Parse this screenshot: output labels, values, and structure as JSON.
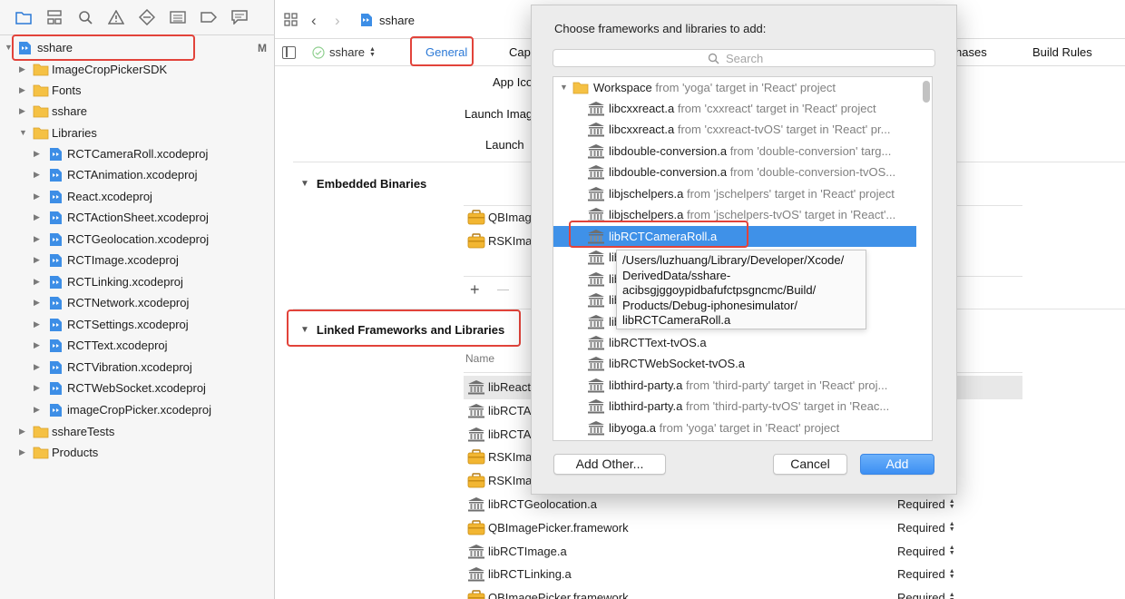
{
  "colors": {
    "accent": "#2a78d6",
    "selection": "#3f91e8",
    "highlight_box": "#e2433a",
    "folder": "#f5c144"
  },
  "navigator": {
    "toolbar_icons": [
      "folder-icon",
      "hierarchy-icon",
      "search-icon",
      "warning-icon",
      "diamond-icon",
      "list-icon",
      "tag-icon",
      "comment-icon"
    ],
    "root": {
      "label": "sshare",
      "badge": "M"
    },
    "items": [
      {
        "label": "ImageCropPickerSDK",
        "kind": "folder"
      },
      {
        "label": "Fonts",
        "kind": "folder"
      },
      {
        "label": "sshare",
        "kind": "folder"
      },
      {
        "label": "Libraries",
        "kind": "folder",
        "expanded": true
      },
      {
        "label": "RCTCameraRoll.xcodeproj",
        "kind": "project"
      },
      {
        "label": "RCTAnimation.xcodeproj",
        "kind": "project"
      },
      {
        "label": "React.xcodeproj",
        "kind": "project"
      },
      {
        "label": "RCTActionSheet.xcodeproj",
        "kind": "project"
      },
      {
        "label": "RCTGeolocation.xcodeproj",
        "kind": "project"
      },
      {
        "label": "RCTImage.xcodeproj",
        "kind": "project"
      },
      {
        "label": "RCTLinking.xcodeproj",
        "kind": "project"
      },
      {
        "label": "RCTNetwork.xcodeproj",
        "kind": "project"
      },
      {
        "label": "RCTSettings.xcodeproj",
        "kind": "project"
      },
      {
        "label": "RCTText.xcodeproj",
        "kind": "project"
      },
      {
        "label": "RCTVibration.xcodeproj",
        "kind": "project"
      },
      {
        "label": "RCTWebSocket.xcodeproj",
        "kind": "project"
      },
      {
        "label": "imageCropPicker.xcodeproj",
        "kind": "project"
      },
      {
        "label": "sshareTests",
        "kind": "folder"
      },
      {
        "label": "Products",
        "kind": "folder"
      }
    ]
  },
  "editor": {
    "breadcrumb": "sshare",
    "target": "sshare",
    "tabs": {
      "general": "General",
      "capabilities": "Cap",
      "build_phases": "hases",
      "build_rules": "Build Rules"
    },
    "labels": {
      "app_icon": "App Ico",
      "launch_images": "Launch Imag",
      "launch": "Launch"
    },
    "embedded": {
      "title": "Embedded Binaries",
      "items": [
        {
          "name": "QBImag"
        },
        {
          "name": "RSKIma"
        }
      ]
    },
    "linked": {
      "title": "Linked Frameworks and Libraries",
      "column_name": "Name",
      "rows": [
        {
          "name": "libReact",
          "status": "",
          "icon": "library"
        },
        {
          "name": "libRCTA",
          "status": "",
          "icon": "library"
        },
        {
          "name": "libRCTA",
          "status": "",
          "icon": "library"
        },
        {
          "name": "RSKIma",
          "status": "",
          "icon": "framework"
        },
        {
          "name": "RSKIma",
          "status": "",
          "icon": "framework"
        },
        {
          "name": "libRCTGeolocation.a",
          "status": "Required",
          "icon": "library"
        },
        {
          "name": "QBImagePicker.framework",
          "status": "Required",
          "icon": "framework"
        },
        {
          "name": "libRCTImage.a",
          "status": "Required",
          "icon": "library"
        },
        {
          "name": "libRCTLinking.a",
          "status": "Required",
          "icon": "library"
        },
        {
          "name": "QBImagePicker.framework",
          "status": "Required",
          "icon": "framework"
        }
      ]
    },
    "add_symbol": "+",
    "remove_symbol": "—"
  },
  "dialog": {
    "title": "Choose frameworks and libraries to add:",
    "search_placeholder": "Search",
    "workspace": {
      "name": "Workspace",
      "from": "from 'yoga' target in 'React' project"
    },
    "items": [
      {
        "name": "libcxxreact.a",
        "from": "from 'cxxreact' target in 'React' project"
      },
      {
        "name": "libcxxreact.a",
        "from": "from 'cxxreact-tvOS' target in 'React' pr..."
      },
      {
        "name": "libdouble-conversion.a",
        "from": "from 'double-conversion' targ..."
      },
      {
        "name": "libdouble-conversion.a",
        "from": "from 'double-conversion-tvOS..."
      },
      {
        "name": "libjschelpers.a",
        "from": "from 'jschelpers' target in 'React' project"
      },
      {
        "name": "libjschelpers.a",
        "from": "from 'jschelpers-tvOS' target in 'React'..."
      },
      {
        "name": "libRCTCameraRoll.a",
        "from": "",
        "selected": true
      },
      {
        "name": "lib",
        "from": ""
      },
      {
        "name": "lib",
        "from": ""
      },
      {
        "name": "lib",
        "from": ""
      },
      {
        "name": "lib",
        "from": ""
      },
      {
        "name": "libRCTText-tvOS.a",
        "from": ""
      },
      {
        "name": "libRCTWebSocket-tvOS.a",
        "from": ""
      },
      {
        "name": "libthird-party.a",
        "from": "from 'third-party' target in 'React' proj..."
      },
      {
        "name": "libthird-party.a",
        "from": "from 'third-party-tvOS' target in 'Reac..."
      },
      {
        "name": "libyoga.a",
        "from": "from 'yoga' target in 'React' project"
      }
    ],
    "tooltip_lines": [
      "/Users/luzhuang/Library/Developer/Xcode/",
      "DerivedData/sshare-",
      "acibsgjggoypidbafufctpsgncmc/Build/",
      "Products/Debug-iphonesimulator/",
      "libRCTCameraRoll.a"
    ],
    "buttons": {
      "add_other": "Add Other...",
      "cancel": "Cancel",
      "add": "Add"
    }
  }
}
